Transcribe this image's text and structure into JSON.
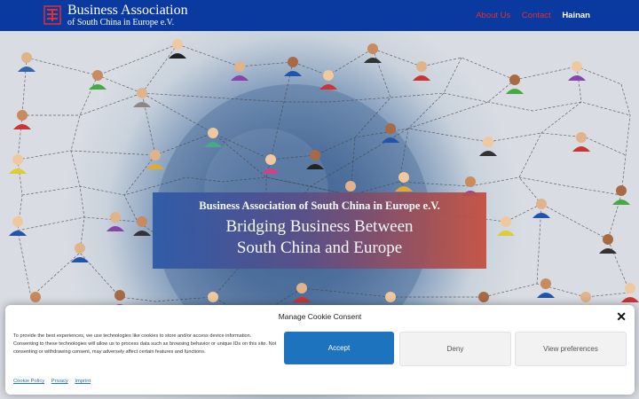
{
  "header": {
    "brand_title": "Business Association",
    "brand_subtitle": "of South China in Europe e.V.",
    "nav": [
      {
        "label": "About Us"
      },
      {
        "label": "Contact"
      },
      {
        "label": "Hainan"
      }
    ]
  },
  "hero": {
    "banner_small": "Business Association of South China in Europe e.V.",
    "banner_line1": "Bridging Business Between",
    "banner_line2": "South China and Europe"
  },
  "cookie": {
    "title": "Manage Cookie Consent",
    "close_icon": "close-icon",
    "text": "To provide the best experiences, we use technologies like cookies to store and/or access device information. Consenting to these technologies will allow us to process data such as browsing behavior or unique IDs on this site. Not consenting or withdrawing consent, may adversely affect certain features and functions.",
    "accept_label": "Accept",
    "deny_label": "Deny",
    "prefs_label": "View preferences",
    "links": [
      {
        "label": "Cookie Policy"
      },
      {
        "label": "Privacy"
      },
      {
        "label": "Imprint"
      }
    ]
  },
  "colors": {
    "header_bg": "#0a3aa0",
    "nav_accent": "#e03030",
    "accept_bg": "#1e73be"
  }
}
